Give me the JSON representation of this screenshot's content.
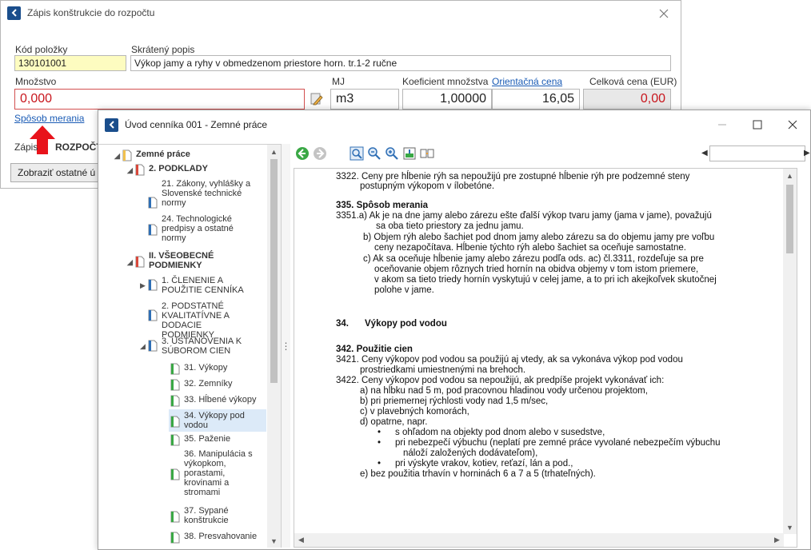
{
  "dialog1": {
    "title": "Zápis konštrukcie do rozpočtu",
    "kod_label": "Kód položky",
    "kod_value": "130101001",
    "popis_label": "Skrátený popis",
    "popis_value": "Výkop jamy a ryhy v obmedzenom priestore horn. tr.1-2 ručne",
    "mnozstvo_label": "Množstvo",
    "mnozstvo_value": "0,000",
    "mj_label": "MJ",
    "mj_value": "m3",
    "koef_label": "Koeficient množstva",
    "koef_value": "1,00000",
    "orient_label": "Orientačná cena",
    "orient_value": "16,05",
    "celkova_label": "Celková cena (EUR)",
    "celkova_value": "0,00",
    "sposob_link": "Spôsob merania",
    "zapis_label": "Zápis",
    "zapis_value": "ROZPOČTU",
    "zobrazit_button": "Zobraziť ostatné ú"
  },
  "window2": {
    "title": "Úvod cenníka 001 - Zemné práce"
  },
  "tree": {
    "root": "Zemné práce",
    "podklady": "2. PODKLADY",
    "zakony": "21. Zákony, vyhlášky a Slovenské technické normy",
    "techn": "24. Technologické predpisy a ostatné normy",
    "vseob": "II. VŠEOBECNÉ PODMIENKY",
    "clenenie": "1. ČLENENIE A POUŽITIE CENNÍKA",
    "podstatne": "2. PODSTATNÉ KVALITATÍVNE A DODACIE PODMIENKY",
    "ustanovenia": "3. USTANOVENIA K SÚBOROM CIEN",
    "vykopy": "31. Výkopy",
    "zemniky": "32. Zemníky",
    "hlbene": "33. Hĺbené výkopy",
    "pod_vodou": "34. Výkopy pod vodou",
    "pazenie": "35. Paženie",
    "manipulacia": "36. Manipulácia s výkopkom, porastami, krovinami a stromami",
    "sypane": "37. Sypané konštrukcie",
    "presvahovanie": "38. Presvahovanie"
  },
  "content_lines": [
    "3322. Ceny pre hĺbenie rýh  sa nepoužijú pre zostupné hĺbenie rýh pre podzemné steny",
    "postupným výkopom v ílobetóne.",
    "335.  Spôsob merania",
    "3351.a) Ak je na dne jamy alebo zárezu ešte ďalší výkop tvaru jamy (jama v jame),  považujú",
    "sa oba tieto priestory za jednu jamu.",
    "b) Objem rýh alebo šachiet pod dnom jamy alebo zárezu sa do objemu jamy pre  voľbu",
    "ceny nezapočítava. Hĺbenie týchto rýh alebo šachiet sa oceňuje    samostatne.",
    "c) Ak sa oceňuje hĺbenie jamy alebo zárezu podľa ods. ac) čl.3311, rozdeľuje sa pre",
    "oceňovanie objem rôznych tried hornín na obidva objemy v tom istom priemere,",
    "v akom sa tieto triedy hornín vyskytujú v celej jame, a to pri ich  akejkoľvek skutočnej",
    "polohe v jame.",
    "34.",
    "Výkopy pod vodou",
    "342.  Použitie cien",
    "3421. Ceny výkopov pod vodou sa použijú aj vtedy, ak sa vykonáva výkop pod vodou",
    "prostriedkami umiestnenými na brehoch.",
    "3422. Ceny výkopov pod vodou sa nepoužijú, ak predpíše projekt vykonávať ich:",
    "a) na hĺbku nad 5 m, pod pracovnou hladinou vody určenou projektom,",
    "b) pri priemernej rýchlosti vody nad 1,5 m/sec,",
    "c) v plavebných komorách,",
    "d) opatrne, napr.",
    "s ohľadom na objekty pod dnom alebo v susedstve,",
    "pri nebezpečí výbuchu (neplatí pre zemné práce vyvolané nebezpečím výbuchu",
    "náloží založených dodávateľom),",
    "pri výskyte vrakov, kotiev, reťazí, lán a pod.,",
    "e) bez použitia trhavín v horninách 6 a 7 a 5 (trhateľných)."
  ],
  "colors": {
    "link": "#1a5bb5",
    "red_value": "#c8161d",
    "highlight_field": "#fdfcc0",
    "selected_tree": "#dceaf8"
  }
}
